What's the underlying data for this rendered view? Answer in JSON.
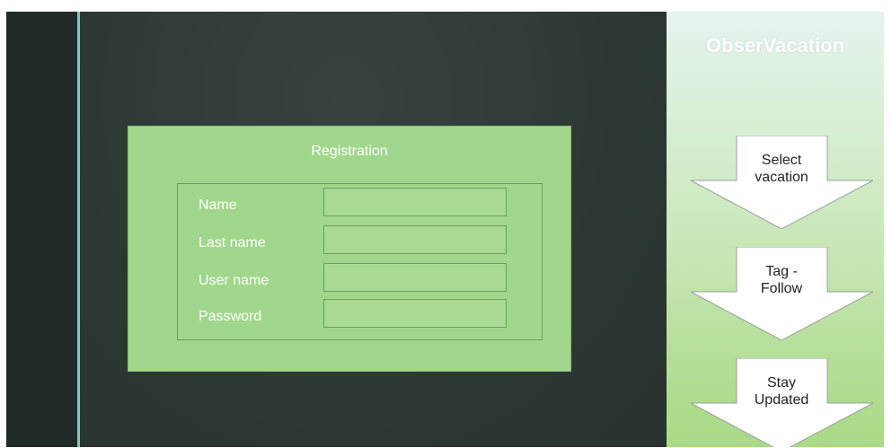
{
  "registration": {
    "title": "Registration",
    "fields": [
      {
        "label": "Name",
        "value": "",
        "placeholder": ""
      },
      {
        "label": "Last name",
        "value": "",
        "placeholder": ""
      },
      {
        "label": "User name",
        "value": "",
        "placeholder": ""
      },
      {
        "label": "Password",
        "value": "",
        "placeholder": ""
      }
    ]
  },
  "sidebar": {
    "brand": "ObserVacation",
    "steps": [
      {
        "line1": "Select",
        "line2": "vacation"
      },
      {
        "line1": "Tag -",
        "line2": "Follow"
      },
      {
        "line1": "Stay",
        "line2": "Updated"
      }
    ]
  },
  "colors": {
    "panel_green": "#a1d78c",
    "dark_background": "#2d3935",
    "accent_teal": "#86c4c0"
  }
}
